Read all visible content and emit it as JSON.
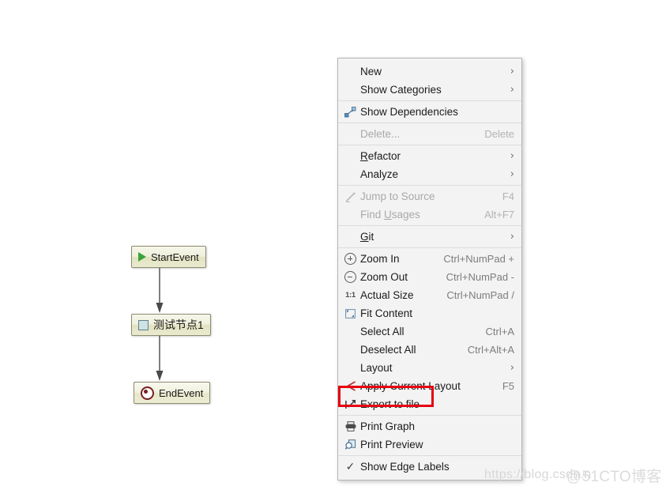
{
  "diagram": {
    "nodes": [
      {
        "id": "start",
        "label": "StartEvent",
        "icon": "play-triangle-icon"
      },
      {
        "id": "task",
        "label": "测试节点1",
        "icon": "task-square-icon"
      },
      {
        "id": "end",
        "label": "EndEvent",
        "icon": "end-circle-icon"
      }
    ],
    "connectors": [
      "arrow-start-to-task",
      "arrow-task-to-end"
    ]
  },
  "context_menu": {
    "groups": [
      {
        "items": [
          {
            "label": "New",
            "accel": "",
            "arrow": "›",
            "icon": "",
            "disabled": false
          },
          {
            "label": "Show Categories",
            "accel": "",
            "arrow": "›",
            "icon": "",
            "disabled": false
          }
        ]
      },
      {
        "items": [
          {
            "label": "Show Dependencies",
            "accel": "",
            "arrow": "",
            "icon": "dependencies-icon",
            "disabled": false
          }
        ]
      },
      {
        "items": [
          {
            "label": "Delete...",
            "accel": "Delete",
            "arrow": "",
            "icon": "",
            "disabled": true
          }
        ]
      },
      {
        "items": [
          {
            "label": "Refactor",
            "accel": "",
            "arrow": "›",
            "icon": "",
            "disabled": false,
            "mnemonic": "R"
          },
          {
            "label": "Analyze",
            "accel": "",
            "arrow": "›",
            "icon": "",
            "disabled": false
          }
        ]
      },
      {
        "items": [
          {
            "label": "Jump to Source",
            "accel": "F4",
            "arrow": "",
            "icon": "pencil-icon",
            "disabled": true
          },
          {
            "label": "Find Usages",
            "accel": "Alt+F7",
            "arrow": "",
            "icon": "",
            "disabled": true,
            "mnemonic": "U"
          }
        ]
      },
      {
        "items": [
          {
            "label": "Git",
            "accel": "",
            "arrow": "›",
            "icon": "",
            "disabled": false,
            "mnemonic": "G"
          }
        ]
      },
      {
        "items": [
          {
            "label": "Zoom In",
            "accel": "Ctrl+NumPad +",
            "arrow": "",
            "icon": "zoom-in-icon",
            "disabled": false
          },
          {
            "label": "Zoom Out",
            "accel": "Ctrl+NumPad -",
            "arrow": "",
            "icon": "zoom-out-icon",
            "disabled": false
          },
          {
            "label": "Actual Size",
            "accel": "Ctrl+NumPad /",
            "arrow": "",
            "icon": "actual-size-icon",
            "disabled": false
          },
          {
            "label": "Fit Content",
            "accel": "",
            "arrow": "",
            "icon": "fit-content-icon",
            "disabled": false
          },
          {
            "label": "Select All",
            "accel": "Ctrl+A",
            "arrow": "",
            "icon": "",
            "disabled": false
          },
          {
            "label": "Deselect All",
            "accel": "Ctrl+Alt+A",
            "arrow": "",
            "icon": "",
            "disabled": false
          },
          {
            "label": "Layout",
            "accel": "",
            "arrow": "›",
            "icon": "",
            "disabled": false
          },
          {
            "label": "Apply Current Layout",
            "accel": "F5",
            "arrow": "",
            "icon": "apply-layout-icon",
            "disabled": false
          },
          {
            "label": "Export to file",
            "accel": "",
            "arrow": "",
            "icon": "export-icon",
            "disabled": false
          }
        ]
      },
      {
        "items": [
          {
            "label": "Print Graph",
            "accel": "",
            "arrow": "",
            "icon": "printer-icon",
            "disabled": false
          },
          {
            "label": "Print Preview",
            "accel": "",
            "arrow": "",
            "icon": "print-preview-icon",
            "disabled": false
          }
        ]
      },
      {
        "items": [
          {
            "label": "Show Edge Labels",
            "accel": "",
            "arrow": "",
            "icon": "check-icon",
            "disabled": false
          }
        ]
      }
    ]
  },
  "highlight": {
    "target": "Export to file",
    "color": "#e60012"
  },
  "watermarks": {
    "csdn": "https://blog.csdn.n",
    "cto": "@51CTO博客"
  },
  "colors": {
    "highlight_red": "#e60012",
    "menu_background": "#f3f3f3",
    "menu_border": "#b5b5b5",
    "node_border": "#8b8b6f",
    "start_icon_green": "#3aa33a",
    "end_icon_red": "#7a1f1f",
    "task_icon_blue": "#cfe2e6",
    "accel_text": "#7d7d7d",
    "disabled_text": "#a9a9a9"
  }
}
